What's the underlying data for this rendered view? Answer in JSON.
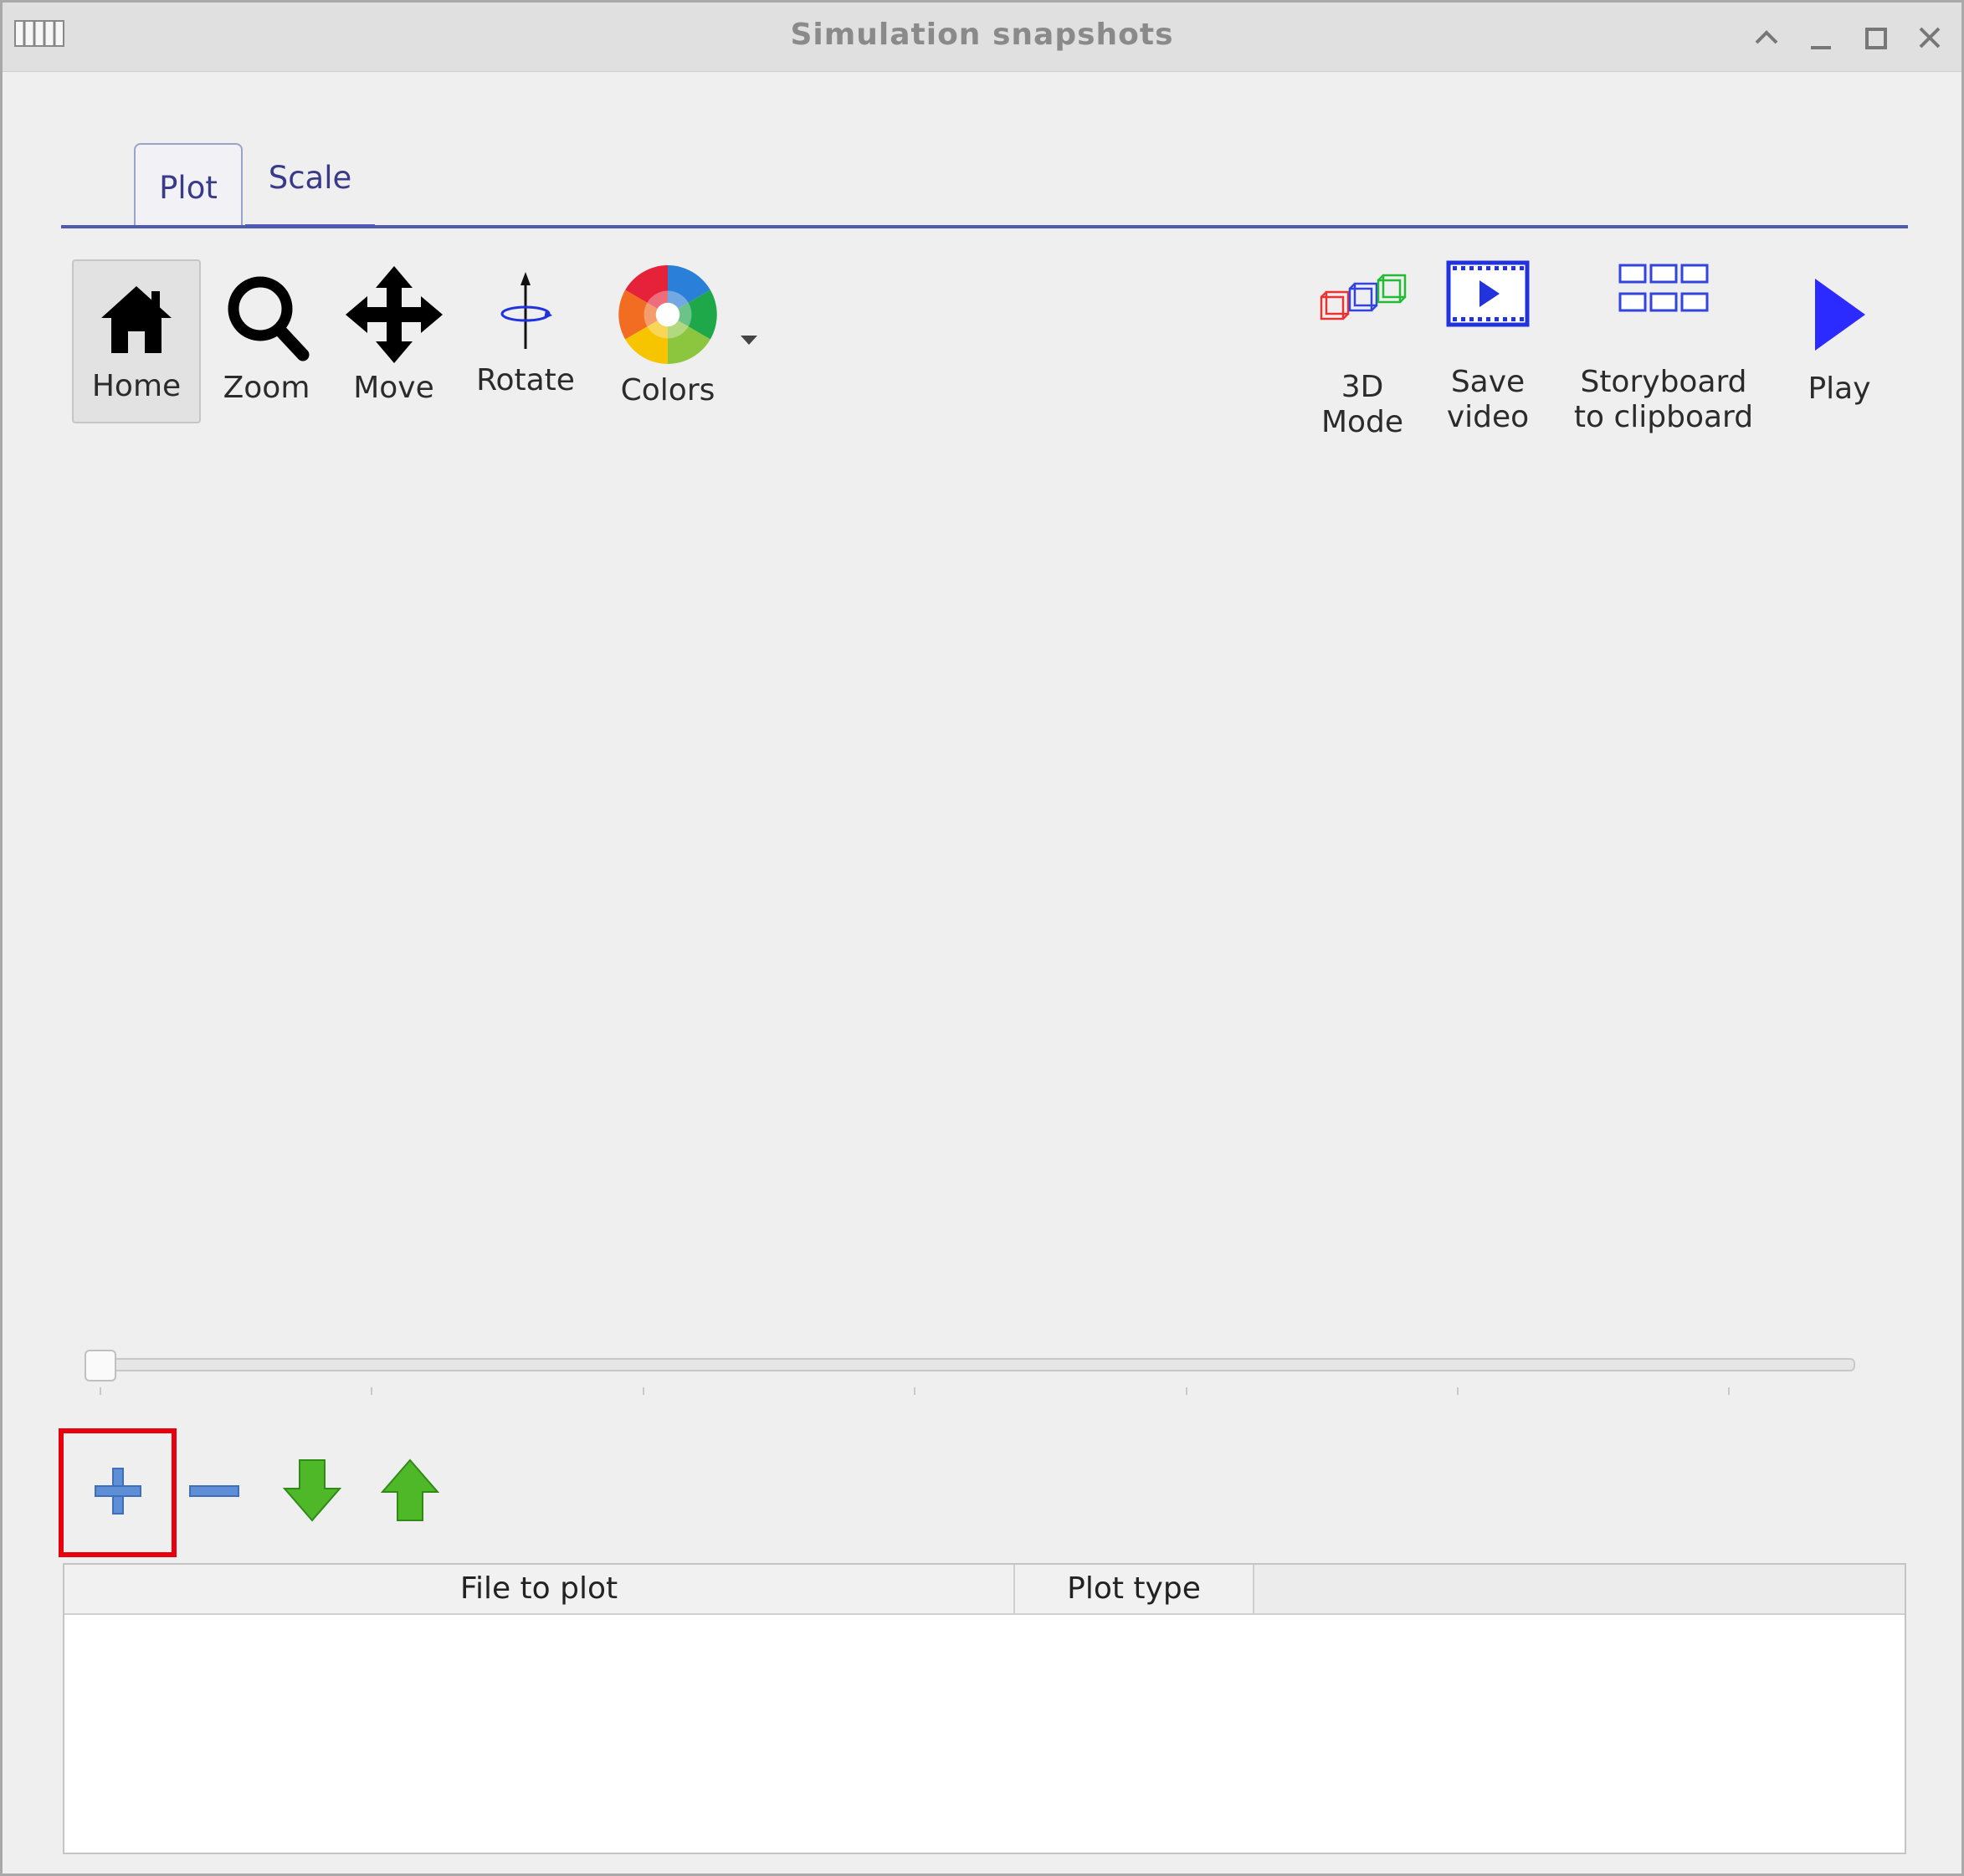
{
  "window": {
    "title": "Simulation snapshots",
    "controls": [
      "keep-above-icon",
      "minimize-icon",
      "maximize-icon",
      "close-icon"
    ]
  },
  "tabs": [
    {
      "label": "Plot",
      "active": true
    },
    {
      "label": "Scale",
      "active": false
    }
  ],
  "toolbar": {
    "left": [
      {
        "label": "Home",
        "icon": "home-icon",
        "pressed": true
      },
      {
        "label": "Zoom",
        "icon": "zoom-icon"
      },
      {
        "label": "Move",
        "icon": "move-icon"
      },
      {
        "label": "Rotate",
        "icon": "rotate-icon"
      },
      {
        "label": "Colors",
        "icon": "color-wheel-icon",
        "has_dropdown": true
      }
    ],
    "right": [
      {
        "line1": "3D",
        "line2": "Mode",
        "icon": "cubes-3d-icon"
      },
      {
        "line1": "Save",
        "line2": "video",
        "icon": "film-icon"
      },
      {
        "line1": "Storyboard",
        "line2": "to clipboard",
        "icon": "storyboard-grid-icon"
      },
      {
        "line1": "Play",
        "line2": "",
        "icon": "play-icon"
      }
    ]
  },
  "slider": {
    "value": 0,
    "tick_count": 7
  },
  "actions": [
    {
      "name": "add-button",
      "icon": "plus-icon",
      "highlighted": true
    },
    {
      "name": "remove-button",
      "icon": "minus-icon"
    },
    {
      "name": "move-down-button",
      "icon": "arrow-down-icon"
    },
    {
      "name": "move-up-button",
      "icon": "arrow-up-icon"
    }
  ],
  "table": {
    "columns": [
      "File to plot",
      "Plot type"
    ],
    "rows": []
  },
  "colors": {
    "accent": "#4d5bb0",
    "highlight": "#e8000e",
    "play": "#2b2bff",
    "arrow_green": "#3f9e1f",
    "plus_blue": "#5e8fd6"
  }
}
